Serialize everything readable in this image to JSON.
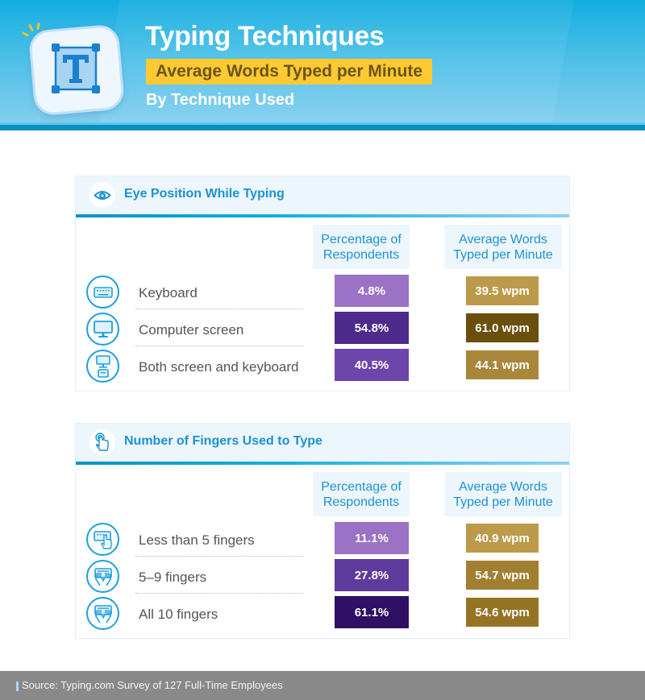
{
  "header": {
    "title": "Typing Techniques",
    "subtitle": "Average Words Typed per Minute",
    "byline": "By Technique Used",
    "logo_icon": "text-tool-icon",
    "colors": {
      "banner": "#4cbfe8",
      "subtitle_bg": "#ffc932",
      "subtitle_text": "#6b5514"
    }
  },
  "sections": [
    {
      "title": "Eye Position While Typing",
      "icon": "eye-icon",
      "col1_header": "Percentage of Respondents",
      "col2_header": "Average Words Typed per Minute",
      "rows": [
        {
          "label": "Keyboard",
          "icon": "keyboard-icon",
          "pct": "4.8%",
          "wpm": "39.5 wpm",
          "pct_color": "#9b72c5",
          "wpm_color": "#bc9a4a"
        },
        {
          "label": "Computer screen",
          "icon": "monitor-icon",
          "pct": "54.8%",
          "wpm": "61.0 wpm",
          "pct_color": "#4e2a8c",
          "wpm_color": "#6b4f0d"
        },
        {
          "label": "Both screen and keyboard",
          "icon": "screen-and-keyboard-icon",
          "pct": "40.5%",
          "wpm": "44.1 wpm",
          "pct_color": "#6e45aa",
          "wpm_color": "#a8873a"
        }
      ]
    },
    {
      "title": "Number of Fingers Used to Type",
      "icon": "finger-tap-icon",
      "col1_header": "Percentage of Respondents",
      "col2_header": "Average Words Typed per Minute",
      "rows": [
        {
          "label": "Less than 5 fingers",
          "icon": "one-hand-typing-icon",
          "pct": "11.1%",
          "wpm": "40.9 wpm",
          "pct_color": "#9b72c5",
          "wpm_color": "#bc9a4a"
        },
        {
          "label": "5–9 fingers",
          "icon": "two-hands-typing-icon",
          "pct": "27.8%",
          "wpm": "54.7 wpm",
          "pct_color": "#5f3a9d",
          "wpm_color": "#a17f31"
        },
        {
          "label": "All 10 fingers",
          "icon": "ten-fingers-typing-icon",
          "pct": "61.1%",
          "wpm": "54.6 wpm",
          "pct_color": "#2f1065",
          "wpm_color": "#957325"
        }
      ]
    }
  ],
  "footer": {
    "source": "Source: Typing.com Survey of 127 Full-Time Employees"
  }
}
